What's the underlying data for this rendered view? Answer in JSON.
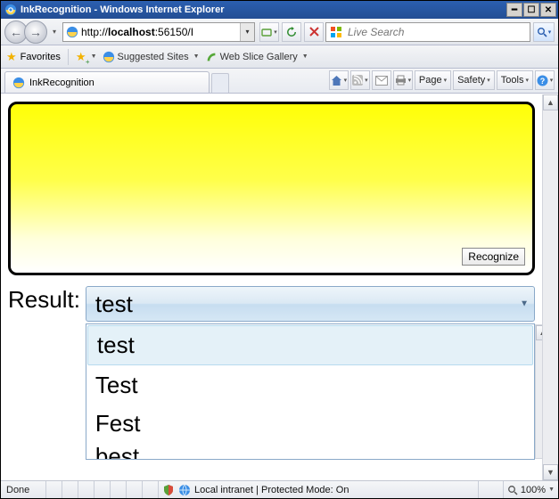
{
  "window": {
    "title": "InkRecognition - Windows Internet Explorer"
  },
  "nav": {
    "url_prefix": "http://",
    "url_host": "localhost",
    "url_rest": ":56150/I",
    "search_placeholder": "Live Search"
  },
  "favorites": {
    "label": "Favorites",
    "suggested": "Suggested Sites",
    "webslice": "Web Slice Gallery"
  },
  "tab": {
    "title": "InkRecognition"
  },
  "cmdbar": {
    "page": "Page",
    "safety": "Safety",
    "tools": "Tools"
  },
  "page": {
    "recognize": "Recognize",
    "result_label": "Result:",
    "combo_value": "test",
    "dropdown": {
      "i0": "test",
      "i1": "Test",
      "i2": "Fest",
      "i3": "best"
    }
  },
  "status": {
    "done": "Done",
    "zone": "Local intranet | Protected Mode: On",
    "zoom": "100%"
  }
}
